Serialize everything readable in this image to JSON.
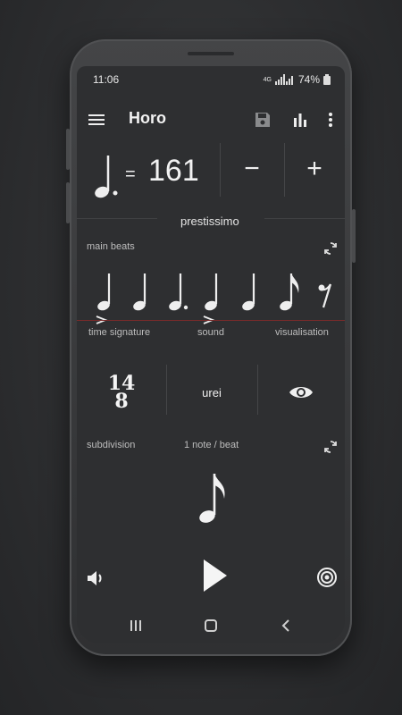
{
  "status": {
    "time": "11:06",
    "network": "4G",
    "battery": "74%"
  },
  "appbar": {
    "title": "Horo",
    "menu_icon": "menu-icon",
    "save_icon": "save-icon",
    "stats_icon": "bar-chart-icon",
    "more_icon": "more-vertical-icon"
  },
  "tempo": {
    "bpm": "161",
    "equals": "=",
    "minus": "−",
    "plus": "+",
    "tempo_name": "prestissimo"
  },
  "main_beats": {
    "label": "main beats",
    "beats": [
      {
        "note": "quarter",
        "accent": true
      },
      {
        "note": "quarter",
        "accent": false
      },
      {
        "note": "dotted-quarter",
        "accent": false
      },
      {
        "note": "quarter",
        "accent": true
      },
      {
        "note": "quarter",
        "accent": false
      },
      {
        "note": "eighth",
        "accent": false
      },
      {
        "note": "eighth-rest",
        "accent": false
      }
    ]
  },
  "columns": {
    "time_signature_label": "time signature",
    "sound_label": "sound",
    "visualisation_label": "visualisation",
    "time_signature_top": "14",
    "time_signature_bottom": "8",
    "sound_value": "urei",
    "visualisation_icon": "eye-icon"
  },
  "subdivision": {
    "label": "subdivision",
    "value": "1 note / beat",
    "note": "eighth"
  },
  "controls": {
    "volume_icon": "volume-icon",
    "play_icon": "play-icon",
    "target_icon": "target-icon"
  },
  "navbar": {
    "recent_icon": "recent-apps-icon",
    "home_icon": "home-icon",
    "back_icon": "back-icon"
  },
  "colors": {
    "screen_bg": "#2e2f31",
    "accent_line": "#7a2a2a",
    "text": "#f2f2f2"
  }
}
